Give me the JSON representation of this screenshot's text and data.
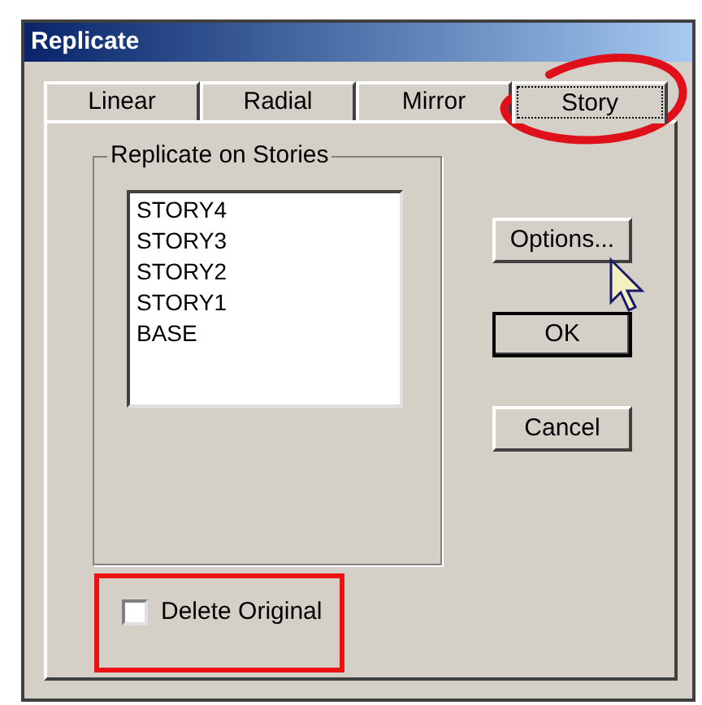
{
  "window": {
    "title": "Replicate"
  },
  "tabs": [
    {
      "label": "Linear",
      "selected": false
    },
    {
      "label": "Radial",
      "selected": false
    },
    {
      "label": "Mirror",
      "selected": false
    },
    {
      "label": "Story",
      "selected": true
    }
  ],
  "group": {
    "title": "Replicate on Stories",
    "stories": [
      "STORY4",
      "STORY3",
      "STORY2",
      "STORY1",
      "BASE"
    ]
  },
  "buttons": [
    {
      "label": "Options...",
      "default": false
    },
    {
      "label": "OK",
      "default": true
    },
    {
      "label": "Cancel",
      "default": false
    }
  ],
  "delete_original": {
    "label": "Delete Original",
    "checked": false
  }
}
